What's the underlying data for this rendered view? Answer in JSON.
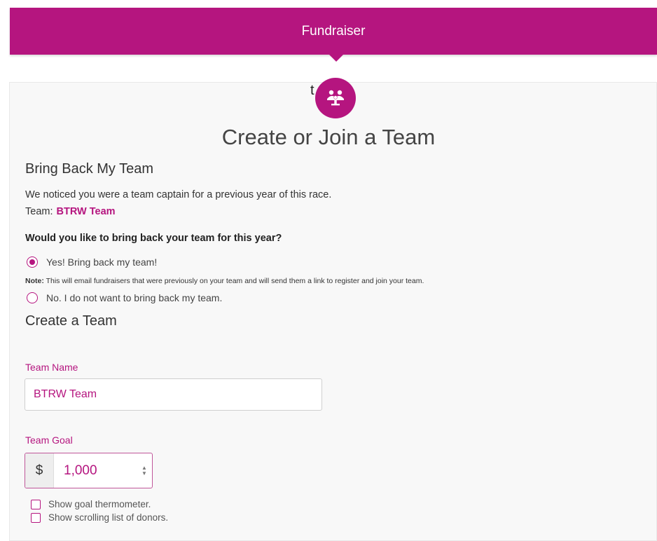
{
  "header": {
    "title": "Fundraiser"
  },
  "card": {
    "stray_char": "t",
    "icon": "team-icon",
    "title": "Create or Join a Team"
  },
  "bring_back": {
    "heading": "Bring Back My Team",
    "message": "We noticed you were a team captain for a previous year of this race.",
    "team_label": "Team:",
    "team_name": "BTRW Team",
    "question": "Would you like to bring back your team for this year?",
    "option_yes": "Yes! Bring back my team!",
    "note_label": "Note:",
    "note_text": "This will email fundraisers that were previously on your team and will send them a link to register and join your team.",
    "option_no": "No. I do not want to bring back my team.",
    "selected": "yes"
  },
  "create_team": {
    "heading": "Create a Team",
    "team_name_label": "Team Name",
    "team_name_value": "BTRW Team",
    "team_goal_label": "Team Goal",
    "currency_symbol": "$",
    "goal_value": "1,000",
    "show_thermometer_label": "Show goal thermometer.",
    "show_thermometer_checked": false,
    "show_donors_label": "Show scrolling list of donors.",
    "show_donors_checked": false
  },
  "colors": {
    "brand": "#b5157f"
  }
}
